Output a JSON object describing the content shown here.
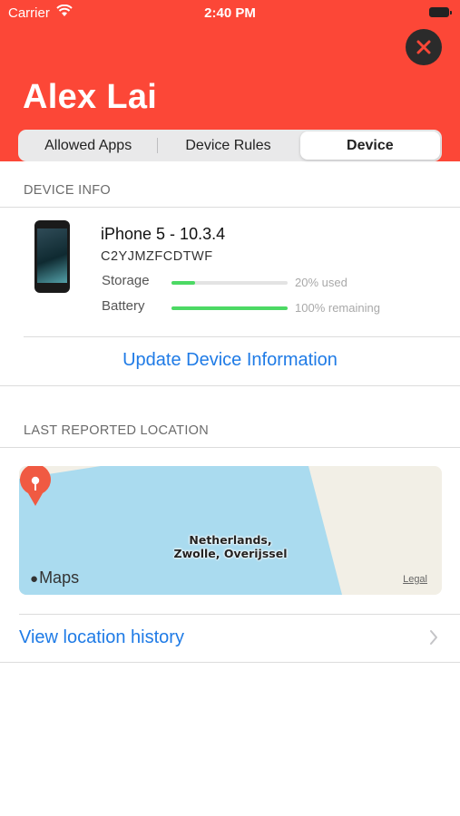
{
  "status_bar": {
    "carrier": "Carrier",
    "time": "2:40 PM"
  },
  "header": {
    "name": "Alex Lai",
    "background_color": "#fc4737",
    "close_icon": "close-icon"
  },
  "tabs": [
    {
      "label": "Allowed Apps",
      "selected": false
    },
    {
      "label": "Device Rules",
      "selected": false
    },
    {
      "label": "Device",
      "selected": true
    }
  ],
  "device_info": {
    "section_title": "DEVICE INFO",
    "model": "iPhone 5 - 10.3.4",
    "serial": "C2YJMZFCDTWF",
    "storage": {
      "label": "Storage",
      "value_text": "20% used",
      "fraction": 0.2
    },
    "battery": {
      "label": "Battery",
      "value_text": "100% remaining",
      "fraction": 1.0
    },
    "update_action": "Update Device Information"
  },
  "location": {
    "section_title": "LAST REPORTED LOCATION",
    "place_line1": "Netherlands,",
    "place_line2": "Zwolle, Overijssel",
    "maps_brand": "Maps",
    "legal": "Legal",
    "history_action": "View location history"
  },
  "colors": {
    "accent": "#1f7be6",
    "progress": "#4cd964",
    "water": "#aadbef",
    "land": "#f2efe6"
  }
}
